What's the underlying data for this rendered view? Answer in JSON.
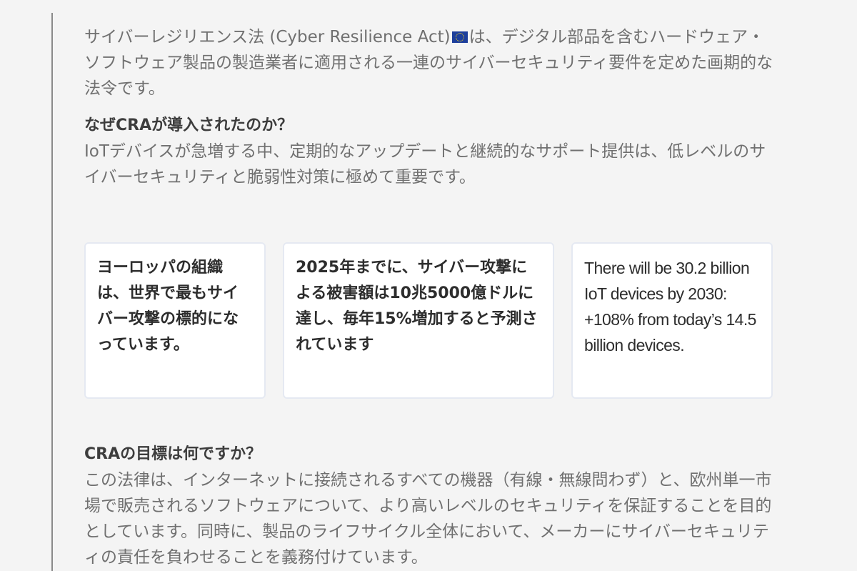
{
  "intro": {
    "before_flag": "サイバーレジリエンス法 (Cyber Resilience Act)",
    "flag_icon": "eu-flag-icon",
    "after_flag": "は、デジタル部品を含むハードウェア・ソフトウェア製品の製造業者に適用される一連のサイバーセキュリティ要件を定めた画期的な法令です。"
  },
  "why": {
    "heading": "なぜCRAが導入されたのか？",
    "text": "IoTデバイスが急増する中、定期的なアップデートと継続的なサポート提供は、低レベルのサイバーセキュリティと脆弱性対策に極めて重要です。"
  },
  "cards": [
    {
      "text": "ヨーロッパの組織は、世界で最もサイバー攻撃の標的になっています。"
    },
    {
      "text": "2025年までに、サイバー攻撃による被害額は10兆5000億ドルに達し、毎年15%増加すると予測されています"
    },
    {
      "text": "There will be 30.2 billion IoT devices by 2030: +108% from today’s 14.5 billion devices."
    }
  ],
  "goal": {
    "heading": "CRAの目標は何ですか？",
    "text": "この法律は、インターネットに接続されるすべての機器（有線・無線問わず）と、欧州単一市場で販売されるソフトウェアについて、より高いレベルのセキュリティを保証することを目的としています。同時に、製品のライフサイクル全体において、メーカーにサイバーセキュリティの責任を負わせることを義務付けています。"
  },
  "colors": {
    "background": "#f4f4f4",
    "body_text": "#707070",
    "heading_text": "#3d3d3d",
    "card_border": "#e5e9f2",
    "eu_flag_blue": "#1d3f9c",
    "eu_flag_stars": "#f7d31e"
  }
}
